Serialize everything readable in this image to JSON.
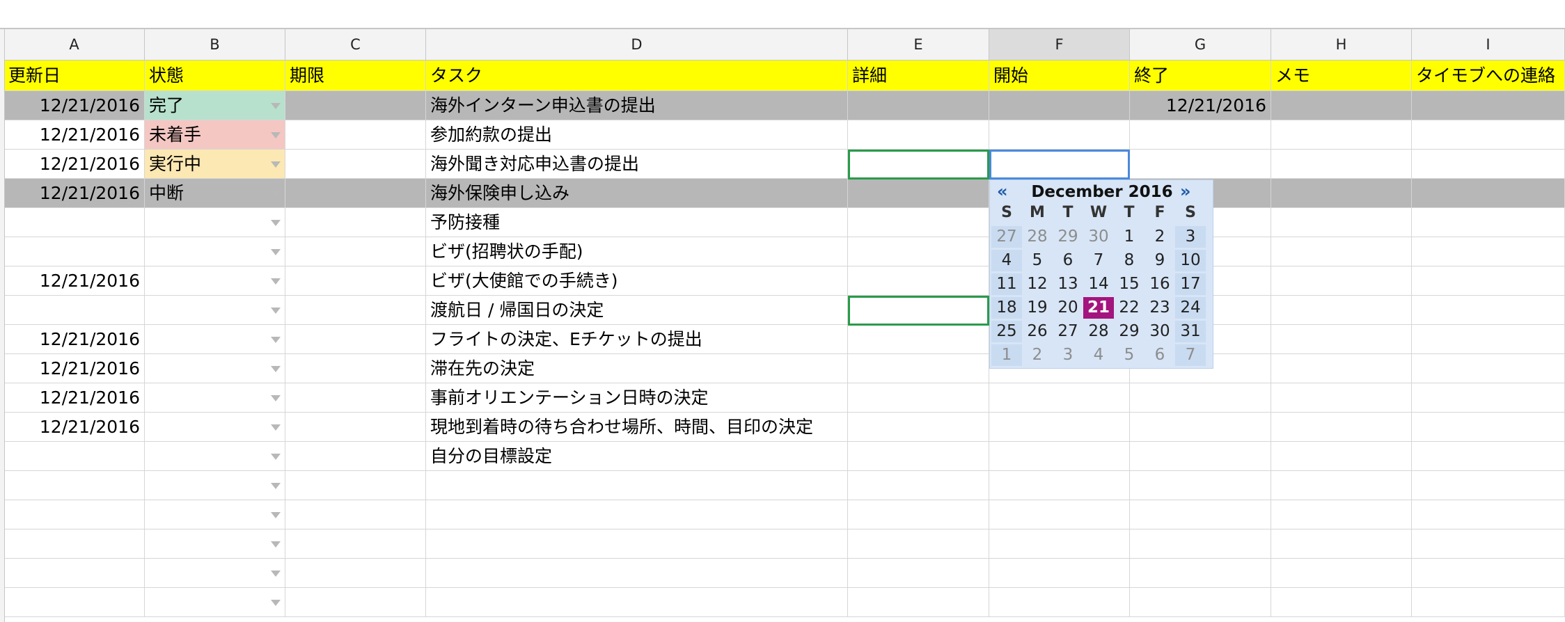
{
  "columns": [
    {
      "key": "A",
      "label": "A"
    },
    {
      "key": "B",
      "label": "B"
    },
    {
      "key": "C",
      "label": "C"
    },
    {
      "key": "D",
      "label": "D"
    },
    {
      "key": "E",
      "label": "E"
    },
    {
      "key": "F",
      "label": "F",
      "selected": true
    },
    {
      "key": "G",
      "label": "G"
    },
    {
      "key": "H",
      "label": "H"
    },
    {
      "key": "I",
      "label": "I"
    }
  ],
  "header_row": [
    "更新日",
    "状態",
    "期限",
    "タスク",
    "詳細",
    "開始",
    "終了",
    "メモ",
    "タイモブへの連絡"
  ],
  "rows": [
    {
      "A": "12/21/2016",
      "B": "完了",
      "status": "done",
      "D": "海外インターン申込書の提出",
      "G": "12/21/2016",
      "highlight": "grey"
    },
    {
      "A": "12/21/2016",
      "B": "未着手",
      "status": "todo",
      "D": "参加約款の提出"
    },
    {
      "A": "12/21/2016",
      "B": "実行中",
      "status": "doing",
      "D": "海外聞き対応申込書の提出"
    },
    {
      "A": "12/21/2016",
      "B": "中断",
      "status": "paused",
      "D": "海外保険申し込み",
      "highlight": "grey"
    },
    {
      "A": "",
      "B": "",
      "D": "予防接種"
    },
    {
      "A": "",
      "B": "",
      "D": "ビザ(招聘状の手配)"
    },
    {
      "A": "12/21/2016",
      "B": "",
      "D": "ビザ(大使館での手続き)"
    },
    {
      "A": "",
      "B": "",
      "D": "渡航日 / 帰国日の決定"
    },
    {
      "A": "12/21/2016",
      "B": "",
      "D": "フライトの決定、Eチケットの提出"
    },
    {
      "A": "12/21/2016",
      "B": "",
      "D": "滞在先の決定"
    },
    {
      "A": "12/21/2016",
      "B": "",
      "D": "事前オリエンテーション日時の決定"
    },
    {
      "A": "12/21/2016",
      "B": "",
      "D": "現地到着時の待ち合わせ場所、時間、目印の決定"
    },
    {
      "A": "",
      "B": "",
      "D": "自分の目標設定"
    },
    {
      "A": "",
      "B": "",
      "D": ""
    },
    {
      "A": "",
      "B": "",
      "D": ""
    },
    {
      "A": "",
      "B": "",
      "D": ""
    },
    {
      "A": "",
      "B": "",
      "D": ""
    },
    {
      "A": "",
      "B": "",
      "D": ""
    }
  ],
  "status_colors": {
    "done": "#b7e1cd",
    "todo": "#f4c7c3",
    "doing": "#fce8b2",
    "paused": "#b7b7b7"
  },
  "header_color": "#ffff00",
  "datepicker": {
    "prev_label": "«",
    "next_label": "»",
    "month_label": "December 2016",
    "weekdays": [
      "S",
      "M",
      "T",
      "W",
      "T",
      "F",
      "S"
    ],
    "weeks": [
      [
        "27",
        "28",
        "29",
        "30",
        "1",
        "2",
        "3"
      ],
      [
        "4",
        "5",
        "6",
        "7",
        "8",
        "9",
        "10"
      ],
      [
        "11",
        "12",
        "13",
        "14",
        "15",
        "16",
        "17"
      ],
      [
        "18",
        "19",
        "20",
        "21",
        "22",
        "23",
        "24"
      ],
      [
        "25",
        "26",
        "27",
        "28",
        "29",
        "30",
        "31"
      ],
      [
        "1",
        "2",
        "3",
        "4",
        "5",
        "6",
        "7"
      ]
    ],
    "other_month_cells": [
      [
        0,
        0
      ],
      [
        0,
        1
      ],
      [
        0,
        2
      ],
      [
        0,
        3
      ],
      [
        5,
        0
      ],
      [
        5,
        1
      ],
      [
        5,
        2
      ],
      [
        5,
        3
      ],
      [
        5,
        4
      ],
      [
        5,
        5
      ],
      [
        5,
        6
      ]
    ],
    "today": "21",
    "today_color": "#a3147e"
  }
}
